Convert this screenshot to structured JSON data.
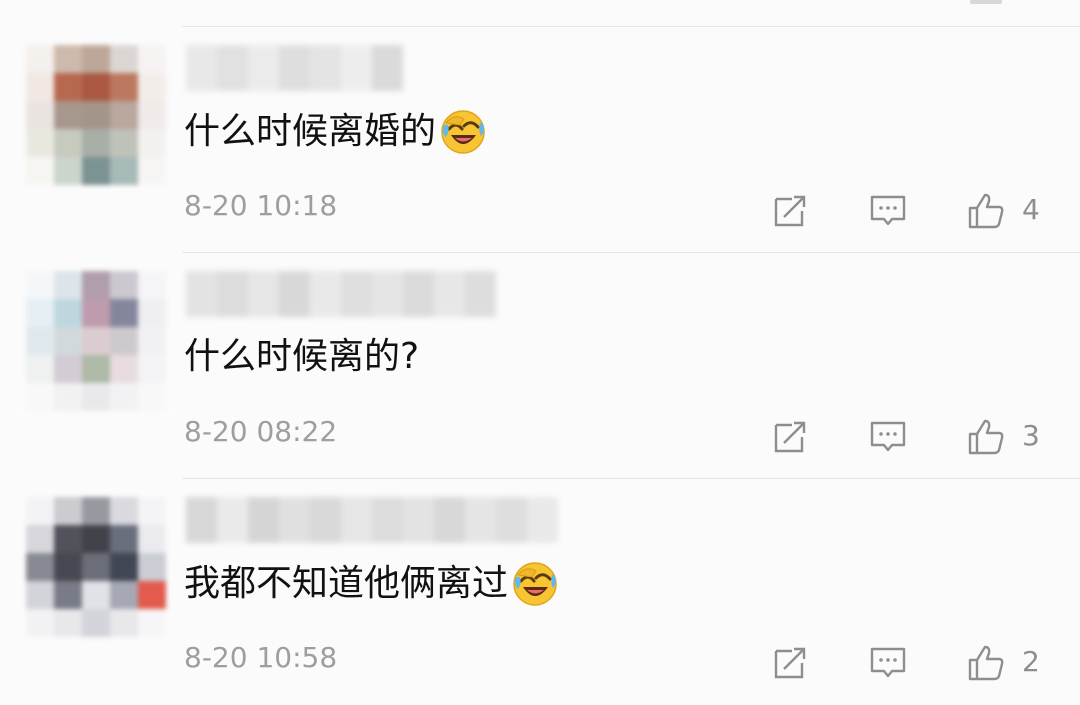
{
  "comments": [
    {
      "text": "什么时候离婚的",
      "has_emoji": true,
      "emoji": "laugh-cry-emoji",
      "timestamp": "8-20 10:18",
      "likes": "4",
      "avatar_colors": [
        "#f4efec",
        "#c9b3a4",
        "#b79f8f",
        "#d8d2cf",
        "#f6f3f2",
        "#f0e6e1",
        "#b05a3e",
        "#a3472e",
        "#b66b4f",
        "#f3ece9",
        "#e9e2df",
        "#a08d80",
        "#9c8a7d",
        "#b39e93",
        "#efe9e7",
        "#e8e7dc",
        "#c1c6b8",
        "#9fa79f",
        "#b9bcb2",
        "#f2f0ee",
        "#f6f5f2",
        "#c7d1c8",
        "#6f8888",
        "#9eb3b0",
        "#f7f5f4"
      ]
    },
    {
      "text": "什么时候离的?",
      "has_emoji": false,
      "emoji": "",
      "timestamp": "8-20 08:22",
      "likes": "3",
      "avatar_colors": [
        "#f5f6f8",
        "#d9e3e8",
        "#a994a4",
        "#c7c3cc",
        "#f5f5f7",
        "#e3eef4",
        "#b8d4dc",
        "#b892a6",
        "#787a92",
        "#eeeef2",
        "#dde8ec",
        "#cdd6d9",
        "#d8c7cd",
        "#c9c5c9",
        "#f1f1f3",
        "#eef0f0",
        "#cfc7d1",
        "#a7b39f",
        "#e6d9dd",
        "#f4f3f5",
        "#f8f8f9",
        "#f1f0f2",
        "#e8e8ea",
        "#f2f2f4",
        "#f8f8f9"
      ]
    },
    {
      "text": "我都不知道他俩离过",
      "has_emoji": true,
      "emoji": "laugh-cry-emoji",
      "timestamp": "8-20 10:58",
      "likes": "2",
      "avatar_colors": [
        "#f3f3f5",
        "#c6c6cc",
        "#8e8e98",
        "#d6d6dc",
        "#f4f4f6",
        "#d3d3d8",
        "#40404a",
        "#2f2f38",
        "#5a6070",
        "#eaeaee",
        "#7c7e88",
        "#343640",
        "#5c5e6a",
        "#2e3444",
        "#c6c9d0",
        "#cfd0d6",
        "#6b6e7c",
        "#dfe0e6",
        "#9ea0ae",
        "#e04a3a",
        "#f2f2f4",
        "#e6e6ea",
        "#cfd0d6",
        "#e6e6ea",
        "#f6f6f8"
      ]
    }
  ],
  "username_blur_colors": [
    [
      "#e8e8e8",
      "#e1e1e1",
      "#ebebeb",
      "#dedede",
      "#e4e4e4",
      "#ededed",
      "#dadada"
    ],
    [
      "#e3e3e3",
      "#dcdcdc",
      "#e6e6e6",
      "#d8d8d8",
      "#e9e9e9",
      "#dfdfdf",
      "#e5e5e5",
      "#dbdbdb",
      "#e7e7e7",
      "#dddddd"
    ],
    [
      "#d7d7d7",
      "#eaeaea",
      "#d5d5d5",
      "#e0e0e0",
      "#d9d9d9",
      "#e6e6e6",
      "#dcdcdc",
      "#e3e3e3",
      "#d8d8d8",
      "#e5e5e5",
      "#dedede",
      "#e9e9e9"
    ]
  ],
  "colors": {
    "text": "#111111",
    "meta": "#9e9e9e",
    "icon": "#8e8e8e",
    "divider": "#e6e6e6"
  }
}
